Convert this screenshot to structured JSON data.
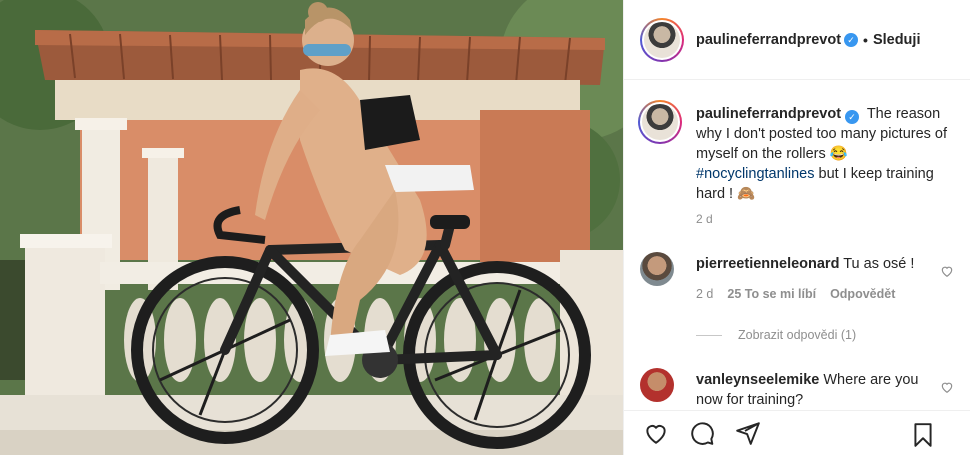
{
  "post": {
    "username": "paulineferrandprevot",
    "follow_label": "Sleduji",
    "caption_text": "The reason why I don't posted too many pictures of myself on the rollers 😂",
    "hashtag": "#nocyclingtanlines",
    "caption_tail": "but I keep training hard ! 🙈",
    "time": "2 d"
  },
  "comments": [
    {
      "username": "pierreetienneleonard",
      "text": "Tu as osé !",
      "time": "2 d",
      "likes": "25 To se mi líbí",
      "reply_label": "Odpovědět",
      "view_replies": "Zobrazit odpovědi (1)"
    },
    {
      "username": "vanleynseelemike",
      "text": "Where are you now for training?"
    }
  ],
  "icons": {
    "like": "heart-icon",
    "comment": "comment-icon",
    "share": "share-icon",
    "save": "bookmark-icon",
    "verified": "verified-badge-icon"
  },
  "colors": {
    "text": "#262626",
    "muted": "#8e8e8e",
    "verified": "#3897f0",
    "hashtag": "#00376b"
  }
}
